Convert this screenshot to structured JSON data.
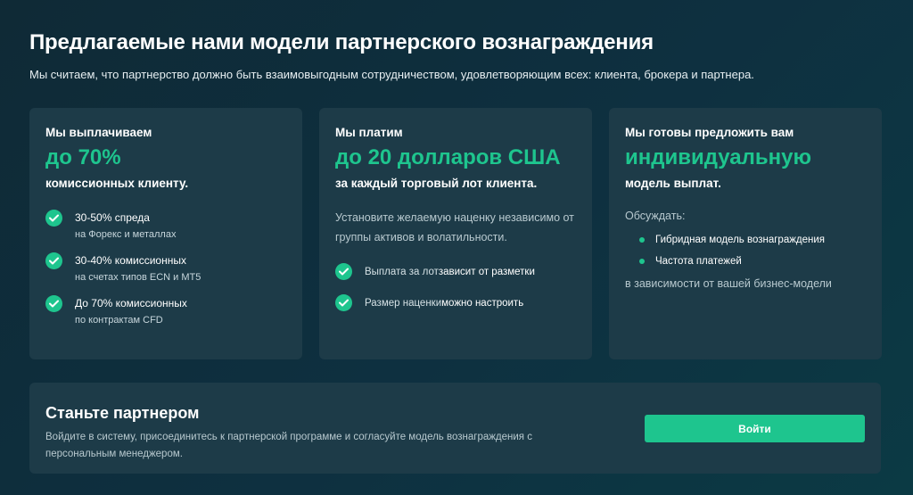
{
  "header": {
    "title": "Предлагаемые нами модели партнерского вознаграждения",
    "subtitle": "Мы считаем, что партнерство должно быть взаимовыгодным сотрудничеством, удовлетворяющим всех: клиента, брокера и партнера."
  },
  "cards": [
    {
      "lead": "Мы выплачиваем",
      "big": "до 70%",
      "tail": "комиссионных клиенту.",
      "features": [
        {
          "title": "30-50% спреда",
          "sub": "на Форекс и металлах"
        },
        {
          "title": "30-40% комиссионных",
          "sub": "на счетах типов ECN и MT5"
        },
        {
          "title": "До 70% комиссионных",
          "sub": "по контрактам CFD"
        }
      ]
    },
    {
      "lead": "Мы платим",
      "big": "до 20 долларов США",
      "tail": "за каждый торговый лот клиента.",
      "desc": "Установите желаемую наценку независимо от группы активов и волатильности.",
      "features": [
        {
          "pre": "Выплата за лот",
          "emph": "зависит от разметки"
        },
        {
          "pre": "Размер наценки",
          "emph": "можно настроить"
        }
      ]
    },
    {
      "lead": "Мы готовы предложить вам",
      "big": "индивидуальную",
      "tail": "модель выплат.",
      "discuss": "Обсуждать:",
      "bullets": [
        "Гибридная модель вознаграждения",
        "Частота платежей"
      ],
      "after": "в зависимости от вашей бизнес-модели"
    }
  ],
  "cta": {
    "title": "Станьте партнером",
    "text": "Войдите в систему, присоединитесь к партнерской программе и согласуйте модель вознаграждения с персональным менеджером.",
    "button_label": "Войти"
  },
  "colors": {
    "accent": "#1ec58e",
    "card_bg": "#1d3b48",
    "page_bg": "#0f2a36"
  },
  "icons": {
    "check": "check-circle-icon",
    "bullet": "bullet-dot-icon"
  }
}
